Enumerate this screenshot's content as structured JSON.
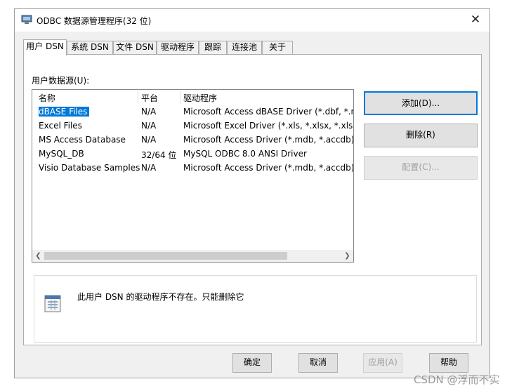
{
  "window": {
    "title": "ODBC 数据源管理程序(32 位)",
    "close_glyph": "✕"
  },
  "tabs": [
    {
      "label": "用户 DSN"
    },
    {
      "label": "系统 DSN"
    },
    {
      "label": "文件 DSN"
    },
    {
      "label": "驱动程序"
    },
    {
      "label": "跟踪"
    },
    {
      "label": "连接池"
    },
    {
      "label": "关于"
    }
  ],
  "active_tab": "用户 DSN",
  "list": {
    "label": "用户数据源(U):",
    "columns": [
      "名称",
      "平台",
      "驱动程序"
    ],
    "rows": [
      {
        "name": "dBASE Files",
        "platform": "N/A",
        "driver": "Microsoft Access dBASE Driver (*.dbf, *.nd"
      },
      {
        "name": "Excel Files",
        "platform": "N/A",
        "driver": "Microsoft Excel Driver (*.xls, *.xlsx, *.xlsm, *"
      },
      {
        "name": "MS Access Database",
        "platform": "N/A",
        "driver": "Microsoft Access Driver (*.mdb, *.accdb)"
      },
      {
        "name": "MySQL_DB",
        "platform": "32/64 位",
        "driver": "MySQL ODBC 8.0 ANSI Driver"
      },
      {
        "name": "Visio Database Samples",
        "platform": "N/A",
        "driver": "Microsoft Access Driver (*.mdb, *.accdb)"
      }
    ],
    "selected_row": "dBASE Files",
    "scroll_left_glyph": "❮",
    "scroll_right_glyph": "❯"
  },
  "buttons": {
    "add": "添加(D)...",
    "remove": "删除(R)",
    "configure": "配置(C)...",
    "ok": "确定",
    "cancel": "取消",
    "apply": "应用(A)",
    "help": "帮助"
  },
  "info": {
    "message": "此用户 DSN 的驱动程序不存在。只能删除它"
  },
  "icons": {
    "app": "odbc-app-icon",
    "info": "data-source-icon"
  },
  "colors": {
    "accent": "#0078d7",
    "selection": "#0078d7",
    "disabled_text": "#a0a0a0"
  },
  "watermark": "CSDN @浮而不实"
}
